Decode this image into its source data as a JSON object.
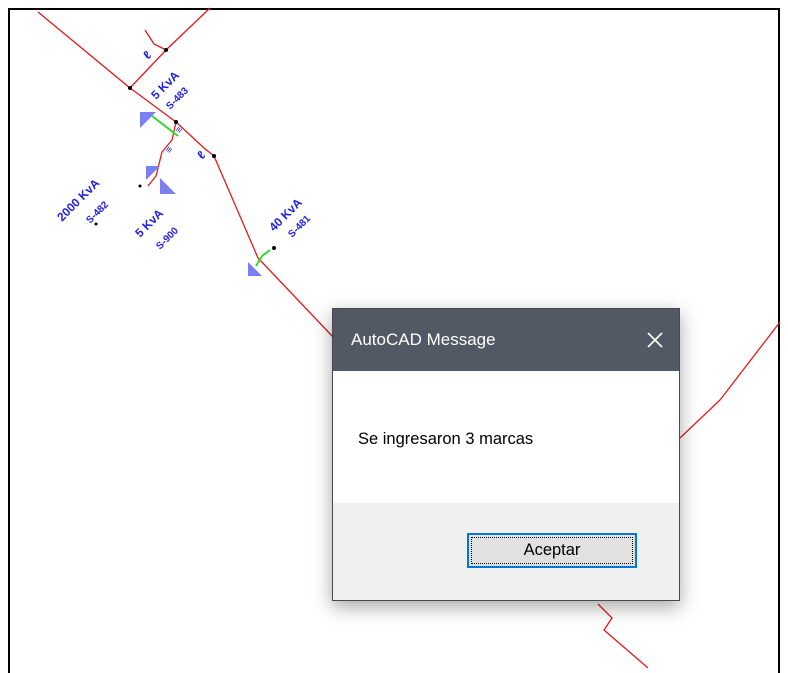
{
  "drawing": {
    "labels": {
      "t1_kva": "5 KvA",
      "t1_id": "S-483",
      "t2_kva": "2000 KvA",
      "t2_id": "S-482",
      "t3_kva": "5 KvA",
      "t3_id": "S-900",
      "t4_kva": "40 KvA",
      "t4_id": "S-481"
    },
    "colors": {
      "line": "#e21b1b",
      "label": "#1f1fe0",
      "marker": "#7b7ff0",
      "green": "#2ddc2d"
    }
  },
  "dialog": {
    "title": "AutoCAD Message",
    "close_icon": "close-icon",
    "message": "Se ingresaron 3 marcas",
    "ok_label": "Aceptar"
  }
}
